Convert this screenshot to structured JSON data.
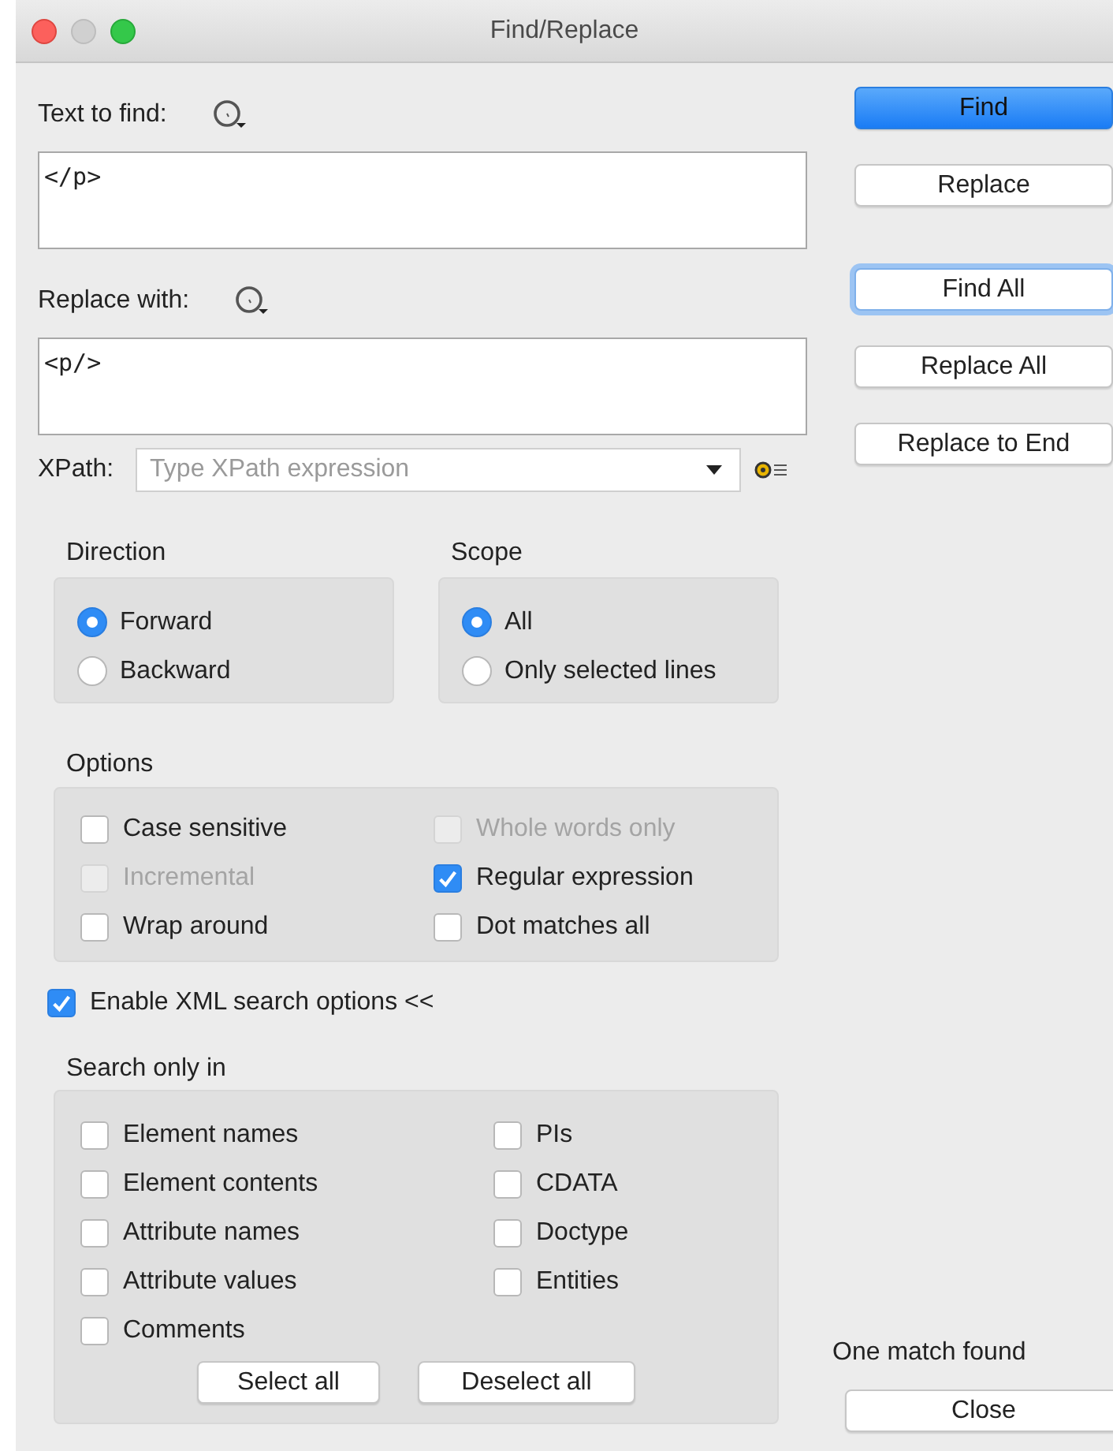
{
  "window": {
    "title": "Find/Replace"
  },
  "find": {
    "label": "Text to find:",
    "value": "</p>"
  },
  "replace": {
    "label": "Replace with:",
    "value": "<p/>"
  },
  "xpath": {
    "label": "XPath:",
    "placeholder": "Type XPath expression"
  },
  "direction": {
    "title": "Direction",
    "options": [
      {
        "label": "Forward",
        "selected": true
      },
      {
        "label": "Backward",
        "selected": false
      }
    ]
  },
  "scope": {
    "title": "Scope",
    "options": [
      {
        "label": "All",
        "selected": true
      },
      {
        "label": "Only selected lines",
        "selected": false
      }
    ]
  },
  "options": {
    "title": "Options",
    "items": [
      {
        "label": "Case sensitive",
        "checked": false,
        "disabled": false
      },
      {
        "label": "Whole words only",
        "checked": false,
        "disabled": true
      },
      {
        "label": "Incremental",
        "checked": false,
        "disabled": true
      },
      {
        "label": "Regular expression",
        "checked": true,
        "disabled": false
      },
      {
        "label": "Wrap around",
        "checked": false,
        "disabled": false
      },
      {
        "label": "Dot matches all",
        "checked": false,
        "disabled": false
      }
    ]
  },
  "xml_toggle": {
    "label": "Enable XML search options <<",
    "checked": true
  },
  "search_only_in": {
    "title": "Search only in",
    "items": [
      {
        "label": "Element names",
        "checked": false
      },
      {
        "label": "Element contents",
        "checked": false
      },
      {
        "label": "Attribute names",
        "checked": false
      },
      {
        "label": "Attribute values",
        "checked": false
      },
      {
        "label": "Comments",
        "checked": false
      },
      {
        "label": "PIs",
        "checked": false
      },
      {
        "label": "CDATA",
        "checked": false
      },
      {
        "label": "Doctype",
        "checked": false
      },
      {
        "label": "Entities",
        "checked": false
      }
    ],
    "buttons": [
      "Select all",
      "Deselect all"
    ]
  },
  "actions": [
    {
      "label": "Find",
      "kind": "default"
    },
    {
      "label": "Replace",
      "kind": "normal"
    },
    {
      "label": "Find All",
      "kind": "focused"
    },
    {
      "label": "Replace All",
      "kind": "normal"
    },
    {
      "label": "Replace to End",
      "kind": "normal"
    }
  ],
  "status": "One match found",
  "close": {
    "label": "Close"
  }
}
